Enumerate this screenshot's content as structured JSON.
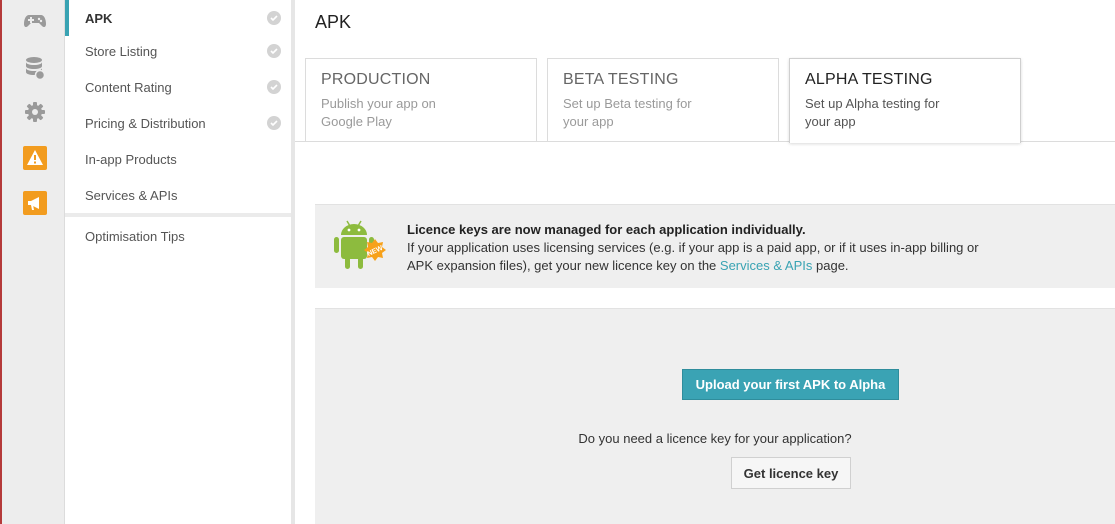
{
  "rail": {
    "icons": [
      "gamepad-icon",
      "database-icon",
      "gear-icon",
      "warning-icon",
      "megaphone-icon"
    ],
    "accent": "#f29c1f"
  },
  "nav": {
    "items": [
      {
        "label": "APK",
        "checked": true,
        "active": true
      },
      {
        "label": "Store Listing",
        "checked": true
      },
      {
        "label": "Content Rating",
        "checked": true
      },
      {
        "label": "Pricing & Distribution",
        "checked": true
      },
      {
        "label": "In-app Products",
        "checked": false
      },
      {
        "label": "Services & APIs",
        "checked": false
      }
    ],
    "tips_label": "Optimisation Tips",
    "accent": "#39a3b3"
  },
  "page": {
    "title": "APK"
  },
  "tabs": [
    {
      "title": "PRODUCTION",
      "desc": "Publish your app on Google Play"
    },
    {
      "title": "BETA TESTING",
      "desc": "Set up Beta testing for your app"
    },
    {
      "title": "ALPHA TESTING",
      "desc": "Set up Alpha testing for your app",
      "active": true
    }
  ],
  "notice": {
    "badge": "NEW",
    "title": "Licence keys are now managed for each application individually.",
    "line1": "If your application uses licensing services (e.g. if your app is a paid app, or if it uses in-app billing or",
    "line2_pre": "APK expansion files), get your new licence key on the ",
    "link": "Services & APIs",
    "line2_post": " page."
  },
  "upload": {
    "button_label": "Upload your first APK to Alpha",
    "licence_question": "Do you need a licence key for your application?",
    "licence_button": "Get licence key"
  }
}
